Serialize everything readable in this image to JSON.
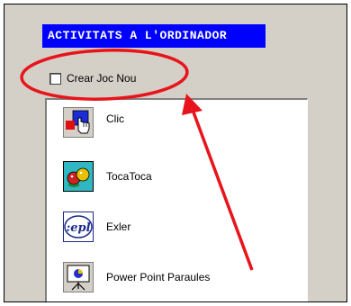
{
  "header": {
    "title": "ACTIVITATS A L'ORDINADOR"
  },
  "checkbox": {
    "label": "Crear Joc Nou",
    "checked": false
  },
  "list": {
    "items": [
      {
        "label": "Clic",
        "icon": "clic-icon"
      },
      {
        "label": "TocaToca",
        "icon": "tocatoca-icon"
      },
      {
        "label": "Exler",
        "icon": "exler-icon"
      },
      {
        "label": "Power Point Paraules",
        "icon": "powerpoint-icon"
      }
    ]
  },
  "annotation": {
    "color": "#e8141c"
  }
}
